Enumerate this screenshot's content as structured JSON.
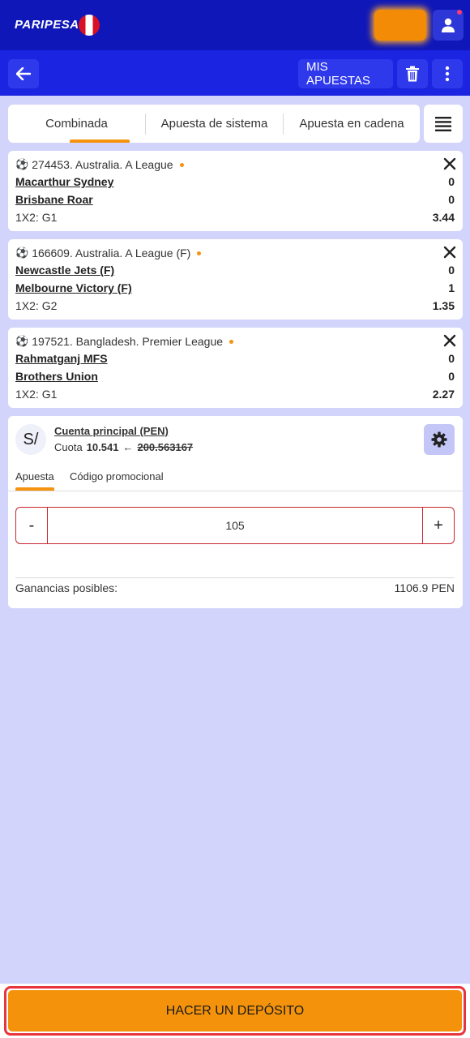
{
  "header": {
    "logo_text": "PARIPESA",
    "flag": "peru-flag",
    "balance_button": "blurred-balance",
    "accent_color": "#0f17b8"
  },
  "toolbar": {
    "my_bets_label": "MIS APUESTAS"
  },
  "tabs": [
    {
      "label": "Combinada",
      "active": true
    },
    {
      "label": "Apuesta de sistema",
      "active": false
    },
    {
      "label": "Apuesta en cadena",
      "active": false
    }
  ],
  "bets": [
    {
      "header": "274453. Australia. A League",
      "team1": "Macarthur Sydney",
      "score1": "0",
      "team2": "Brisbane Roar",
      "score2": "0",
      "market": "1X2: G1",
      "odd": "3.44"
    },
    {
      "header": "166609. Australia. A League (F)",
      "team1": "Newcastle Jets (F)",
      "score1": "0",
      "team2": "Melbourne Victory (F)",
      "score2": "1",
      "market": "1X2: G2",
      "odd": "1.35"
    },
    {
      "header": "197521. Bangladesh. Premier League",
      "team1": "Rahmatganj MFS",
      "score1": "0",
      "team2": "Brothers Union",
      "score2": "0",
      "market": "1X2: G1",
      "odd": "2.27"
    }
  ],
  "slip": {
    "currency_symbol": "S/",
    "account_name": "Cuenta principal (PEN)",
    "quota_label": "Cuota",
    "quota_new": "10.541",
    "quota_arrow": "←",
    "quota_old": "200.563167",
    "tab_stake": "Apuesta",
    "tab_promo": "Código promocional",
    "minus": "-",
    "plus": "+",
    "stake_value": "105",
    "gain_label": "Ganancias posibles:",
    "gain_value": "1106.9 PEN"
  },
  "deposit": {
    "label": "HACER UN DEPÓSITO"
  }
}
